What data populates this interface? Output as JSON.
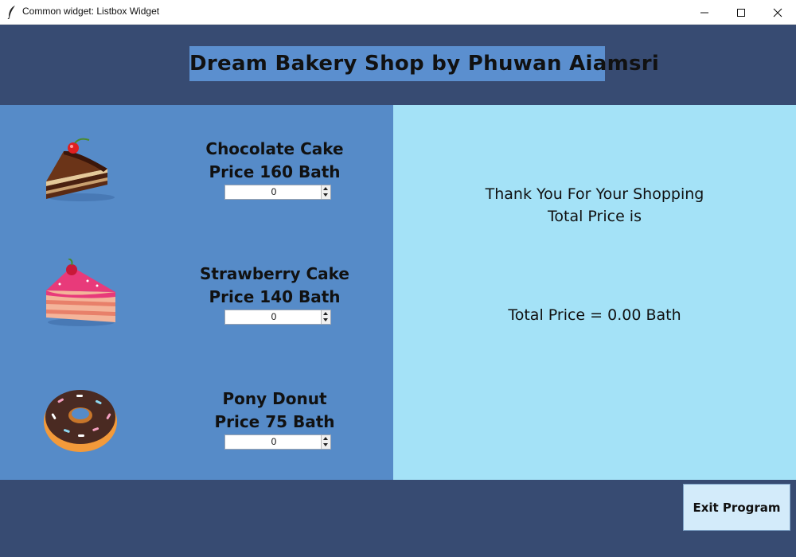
{
  "window": {
    "title": "Common widget: Listbox Widget",
    "icons": [
      "feather-icon",
      "minimize-icon",
      "maximize-icon",
      "close-icon"
    ]
  },
  "header": {
    "shop_title": "Dream Bakery Shop by Phuwan Aiamsri"
  },
  "products": [
    {
      "name": "Chocolate Cake",
      "price": "Price 160 Bath",
      "quantity": "0",
      "icon": "chocolate-cake-icon"
    },
    {
      "name": "Strawberry Cake",
      "price": "Price 140 Bath",
      "quantity": "0",
      "icon": "strawberry-cake-icon"
    },
    {
      "name": "Pony Donut",
      "price": "Price 75 Bath",
      "quantity": "0",
      "icon": "donut-icon"
    }
  ],
  "summary": {
    "thanks_line1": "Thank You For Your Shopping",
    "thanks_line2": "Total Price is",
    "total": "Total Price = 0.00 Bath"
  },
  "footer": {
    "exit_label": "Exit Program"
  },
  "colors": {
    "header_bg": "#374b72",
    "left_panel_bg": "#568bc8",
    "right_panel_bg": "#a4e2f7",
    "title_bg": "#5b8fcf",
    "exit_button_bg": "#d3ebfa"
  }
}
